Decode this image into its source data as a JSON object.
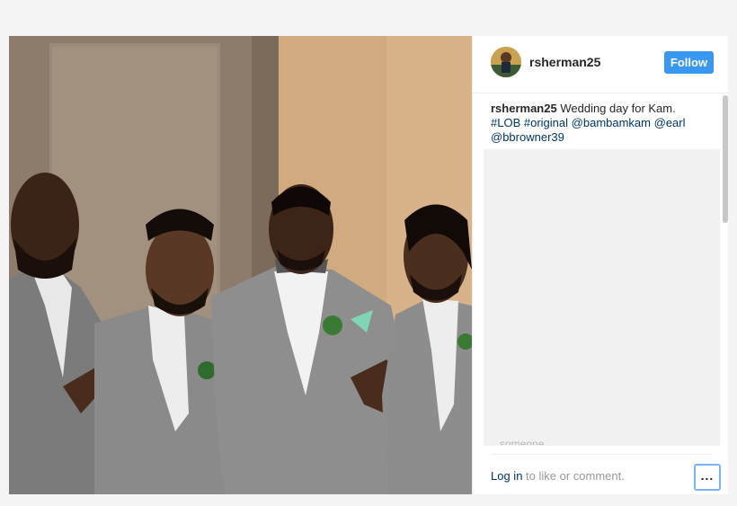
{
  "post": {
    "username": "rsherman25",
    "follow_label": "Follow",
    "caption_user": "rsherman25",
    "caption_text": "Wedding day for Kam.",
    "tags": [
      "#LOB",
      "#original",
      "@bambamkam",
      "@earl",
      "@bbrowner39"
    ],
    "partial_comment": "someone",
    "login_link": "Log in",
    "login_suffix": "to like or comment.",
    "more_label": "..."
  },
  "colors": {
    "accent": "#3897f0",
    "link": "#003569"
  },
  "icons": {
    "more": "more-options-icon"
  }
}
